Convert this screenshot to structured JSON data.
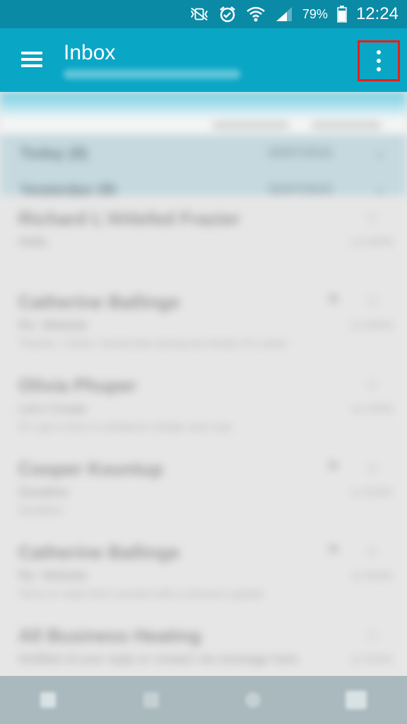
{
  "status_bar": {
    "battery_percent": "79%",
    "time": "12:24",
    "icons": [
      "mute-vibrate-icon",
      "alarm-icon",
      "wifi-icon",
      "signal-icon",
      "battery-icon"
    ]
  },
  "app_bar": {
    "title": "Inbox",
    "menu_icon": "hamburger-menu-icon",
    "overflow_icon": "more-vert-icon",
    "color": "#0aa6c6",
    "highlight_color": "#e3211a"
  },
  "list": {
    "groups": [
      {
        "label": "Today (8)",
        "date": "03/07/2015"
      },
      {
        "label": "Yesterday (8)",
        "date": "02/07/2015"
      }
    ],
    "messages": [
      {
        "sender": "Richard L'Ahlefed Frazier",
        "line2": "Hello",
        "line3": "",
        "date": "12:40PM",
        "flag": false
      },
      {
        "sender": "Catherine Ballinge",
        "line2": "Re: Website",
        "line3": "Thanks, I think I found that during the break of a short",
        "date": "12:30PM",
        "flag": true
      },
      {
        "sender": "Olivia Phuper",
        "line2": "Let's Create",
        "line3": "Hi I got a time to whatever simple and vast",
        "date": "12:10PM",
        "flag": false
      },
      {
        "sender": "Cooper Kountup",
        "line2": "Deadline",
        "line3": "Deadline",
        "date": "11:50AM",
        "flag": true
      },
      {
        "sender": "Catherine Ballinge",
        "line2": "Re: Website",
        "line3": "Sorry to reply that I posted with a pictures update",
        "date": "11:30AM",
        "flag": true
      },
      {
        "sender": "All Business Heating",
        "line2": "Notified of your reply or contact via message here",
        "line3": "",
        "date": "11:00AM",
        "flag": false
      }
    ]
  }
}
